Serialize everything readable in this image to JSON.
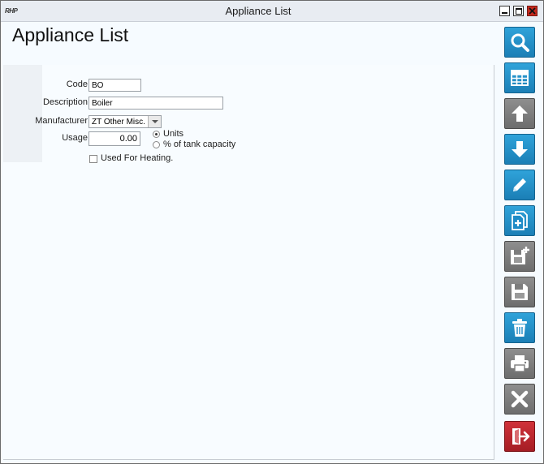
{
  "window": {
    "title": "Appliance List",
    "logo_text": "RHP"
  },
  "page": {
    "title": "Appliance List"
  },
  "form": {
    "code": {
      "label": "Code",
      "value": "BO"
    },
    "description": {
      "label": "Description",
      "value": "Boiler"
    },
    "manufacturer": {
      "label": "Manufacturer",
      "value": "ZT Other Misc."
    },
    "usage": {
      "label": "Usage",
      "value": "0.00",
      "options": [
        {
          "label": "Units",
          "selected": true
        },
        {
          "label": "% of tank capacity",
          "selected": false
        }
      ]
    },
    "heating": {
      "label": "Used For Heating.",
      "checked": false
    }
  },
  "toolbar": {
    "buttons": [
      {
        "name": "search",
        "icon": "search-icon",
        "color": "#1f8cc7"
      },
      {
        "name": "table",
        "icon": "table-icon",
        "color": "#1f8cc7"
      },
      {
        "name": "up",
        "icon": "arrow-up-icon",
        "color": "#7d7d7d"
      },
      {
        "name": "down",
        "icon": "arrow-down-icon",
        "color": "#1f8cc7"
      },
      {
        "name": "edit",
        "icon": "pencil-icon",
        "color": "#1f8cc7"
      },
      {
        "name": "new",
        "icon": "new-document-icon",
        "color": "#1f8cc7"
      },
      {
        "name": "save-new",
        "icon": "save-plus-icon",
        "color": "#7d7d7d"
      },
      {
        "name": "save",
        "icon": "save-icon",
        "color": "#7d7d7d"
      },
      {
        "name": "delete",
        "icon": "trash-icon",
        "color": "#1f8cc7"
      },
      {
        "name": "print",
        "icon": "printer-icon",
        "color": "#7d7d7d"
      },
      {
        "name": "cancel",
        "icon": "close-x-icon",
        "color": "#7d7d7d"
      },
      {
        "name": "exit",
        "icon": "exit-icon",
        "color": "#b8262d"
      }
    ]
  }
}
